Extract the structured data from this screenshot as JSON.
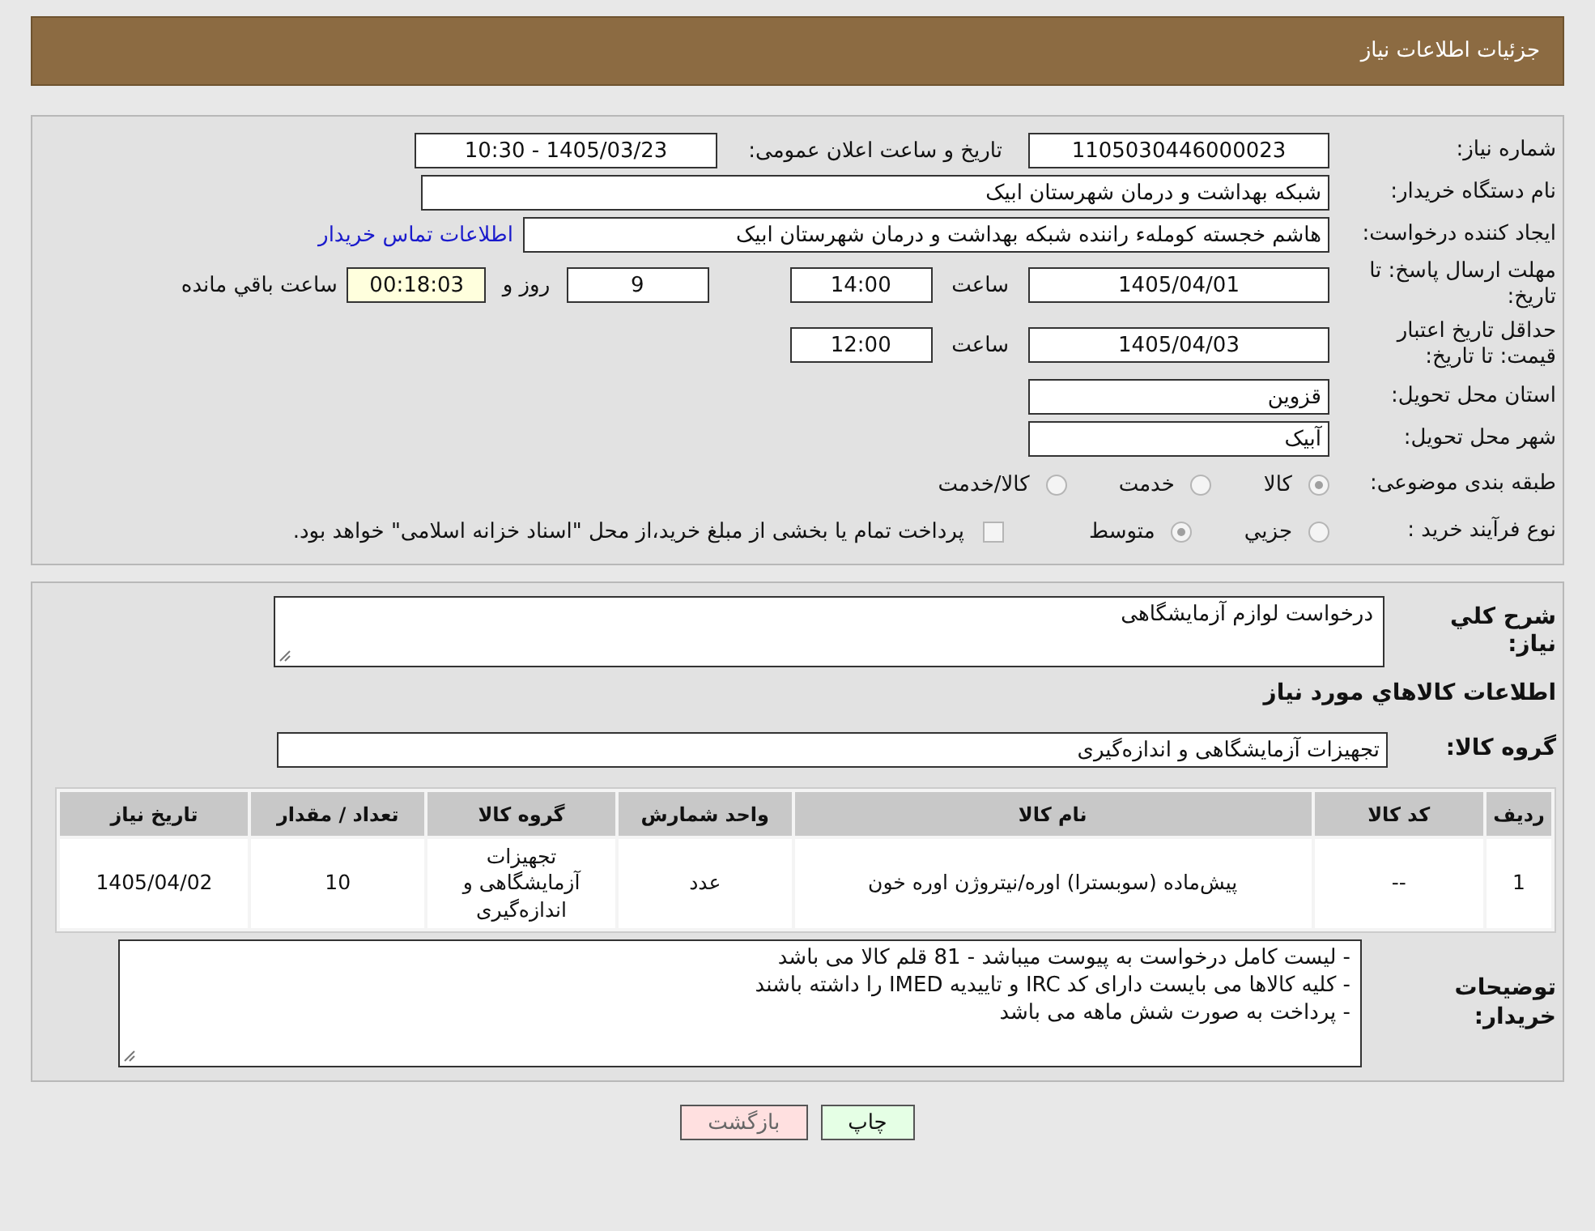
{
  "header": {
    "title": "جزئیات اطلاعات نیاز"
  },
  "need_number": {
    "label": "شماره نیاز:",
    "value": "1105030446000023"
  },
  "announce": {
    "label": "تاریخ و ساعت اعلان عمومی:",
    "value": "1405/03/23 - 10:30"
  },
  "buyer": {
    "label": "نام دستگاه خریدار:",
    "value": "شبکه بهداشت و درمان شهرستان ابیک"
  },
  "creator": {
    "label": "ایجاد کننده درخواست:",
    "value": "هاشم خجسته کوملهء راننده شبکه بهداشت و درمان شهرستان ابیک",
    "link": "اطلاعات تماس خریدار"
  },
  "reply_deadline": {
    "label": "مهلت ارسال پاسخ: تا تاریخ:",
    "date": "1405/04/01",
    "time_label": "ساعت",
    "time": "14:00",
    "days": "9",
    "days_label": "روز و",
    "remaining": "00:18:03",
    "remaining_label": "ساعت باقي مانده"
  },
  "price_validity": {
    "label": "حداقل تاریخ اعتبار قیمت: تا تاریخ:",
    "date": "1405/04/03",
    "time_label": "ساعت",
    "time": "12:00"
  },
  "province": {
    "label": "استان محل تحویل:",
    "value": "قزوین"
  },
  "city": {
    "label": "شهر محل تحویل:",
    "value": "آبیک"
  },
  "category": {
    "label": "طبقه بندی موضوعی:",
    "options": [
      {
        "label": "کالا",
        "selected": true
      },
      {
        "label": "خدمت",
        "selected": false
      },
      {
        "label": "کالا/خدمت",
        "selected": false
      }
    ]
  },
  "process": {
    "label": "نوع فرآیند خرید :",
    "options": [
      {
        "label": "جزيي",
        "selected": false
      },
      {
        "label": "متوسط",
        "selected": true
      }
    ],
    "payment": {
      "label": "پرداخت تمام یا بخشی از مبلغ خرید،از محل \"اسناد خزانه اسلامی\" خواهد بود.",
      "checked": false
    }
  },
  "description": {
    "label": "شرح کلي نیاز:",
    "value": "درخواست لوازم آزمایشگاهی"
  },
  "goods_heading": "اطلاعات کالاهاي مورد نیاز",
  "goods_group": {
    "label": "گروه کالا:",
    "value": "تجهیزات آزمایشگاهی و اندازه‌گیری"
  },
  "table": {
    "columns": [
      "ردیف",
      "کد کالا",
      "نام کالا",
      "واحد شمارش",
      "گروه کالا",
      "تعداد / مقدار",
      "تاریخ نیاز"
    ],
    "rows": [
      [
        "1",
        "--",
        "پیش‌ماده (سوبسترا) اوره/نیتروژن اوره خون",
        "عدد",
        "تجهیزات آزمایشگاهی و اندازه‌گیری",
        "10",
        "1405/04/02"
      ]
    ]
  },
  "notes": {
    "label": "توضیحات خریدار:",
    "lines": [
      "- لیست کامل درخواست به پیوست میباشد - 81 قلم کالا می باشد",
      "- کلیه کالاها می بایست دارای کد IRC و تاییدیه IMED را داشته باشند",
      "- پرداخت به صورت شش ماهه می باشد"
    ]
  },
  "buttons": [
    {
      "kind": "print",
      "label": "چاپ"
    },
    {
      "kind": "back",
      "label": "بازگشت"
    }
  ]
}
